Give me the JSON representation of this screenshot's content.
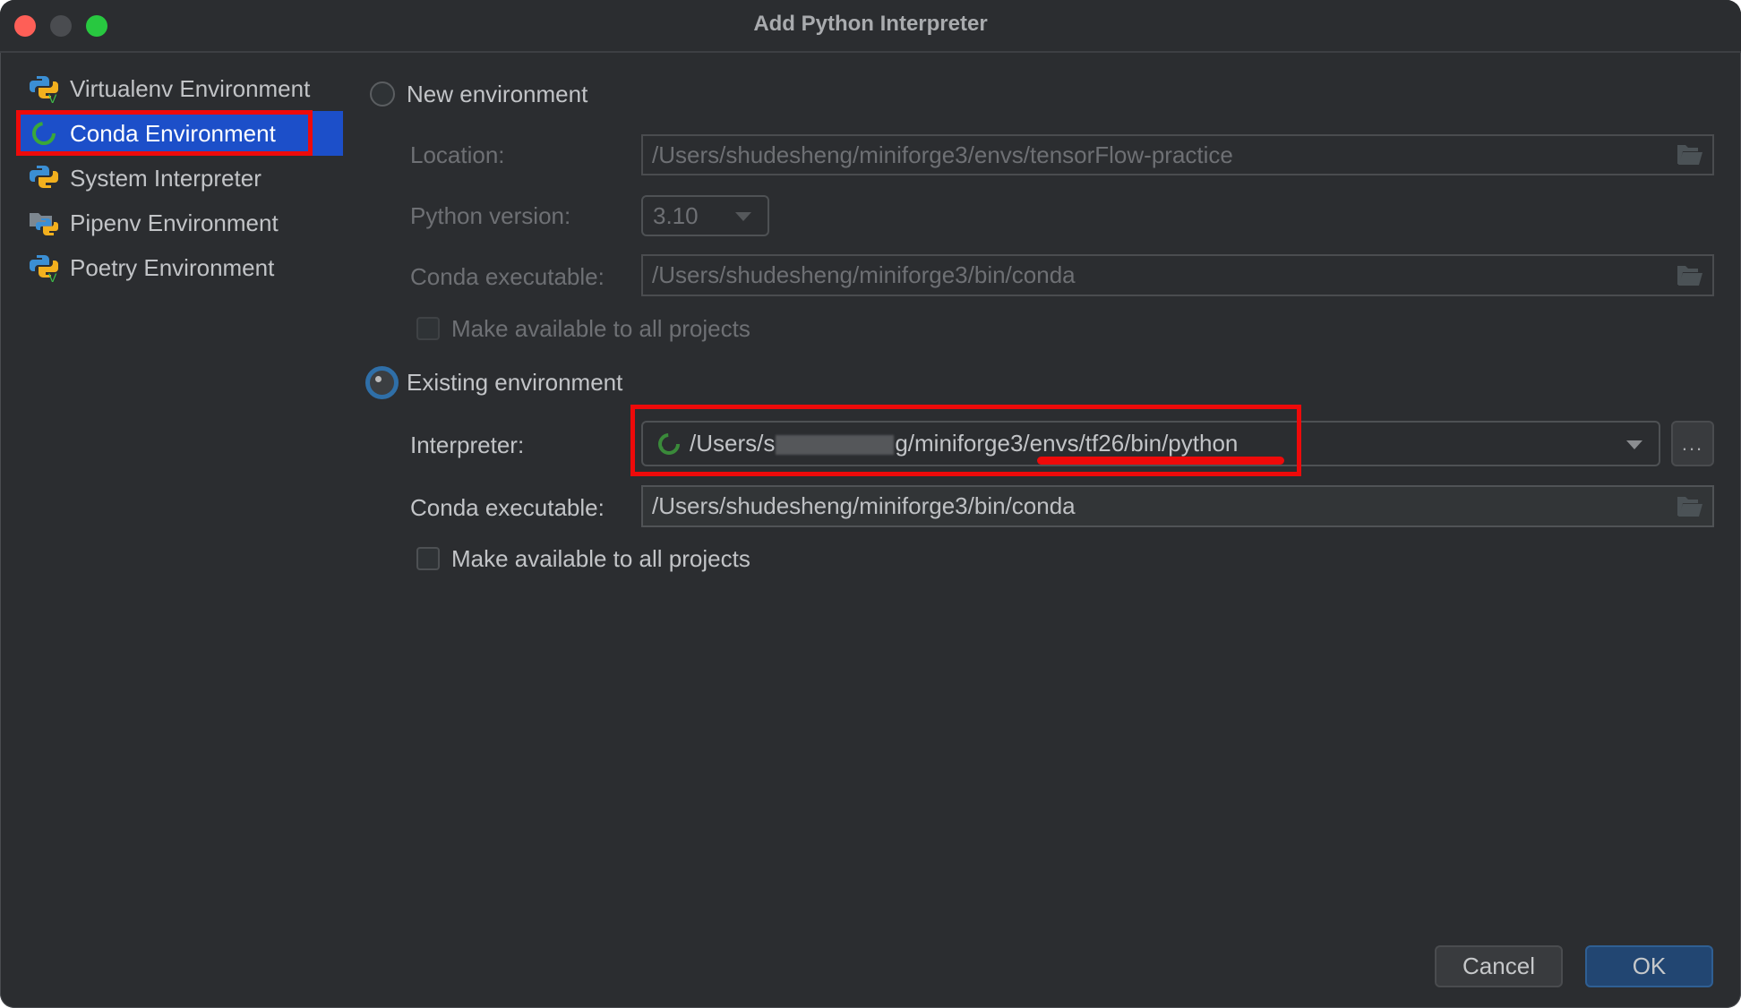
{
  "window": {
    "title": "Add Python Interpreter"
  },
  "sidebar": {
    "items": [
      {
        "label": "Virtualenv Environment",
        "icon": "python-virtualenv-icon",
        "selected": false
      },
      {
        "label": "Conda Environment",
        "icon": "conda-icon",
        "selected": true
      },
      {
        "label": "System Interpreter",
        "icon": "python-icon",
        "selected": false
      },
      {
        "label": "Pipenv Environment",
        "icon": "pipenv-icon",
        "selected": false
      },
      {
        "label": "Poetry Environment",
        "icon": "python-poetry-icon",
        "selected": false
      }
    ]
  },
  "new_environment": {
    "label": "New environment",
    "selected": false,
    "location_label": "Location:",
    "location_value": "/Users/shudesheng/miniforge3/envs/tensorFlow-practice",
    "python_version_label": "Python version:",
    "python_version_value": "3.10",
    "conda_exec_label": "Conda executable:",
    "conda_exec_value": "/Users/shudesheng/miniforge3/bin/conda",
    "make_available_label": "Make available to all projects",
    "make_available_checked": false
  },
  "existing_environment": {
    "label": "Existing environment",
    "selected": true,
    "interpreter_label": "Interpreter:",
    "interpreter_prefix": "/Users/s",
    "interpreter_suffix": "g/miniforge3/envs/tf26/bin/python",
    "browse_label": "...",
    "conda_exec_label": "Conda executable:",
    "conda_exec_value": "/Users/shudesheng/miniforge3/bin/conda",
    "make_available_label": "Make available to all projects",
    "make_available_checked": false
  },
  "footer": {
    "cancel_label": "Cancel",
    "ok_label": "OK"
  },
  "colors": {
    "selection_blue": "#1c4fc9",
    "annotation_red": "#ee0a0a",
    "ok_blue": "#224672",
    "conda_green": "#3aa83a"
  }
}
